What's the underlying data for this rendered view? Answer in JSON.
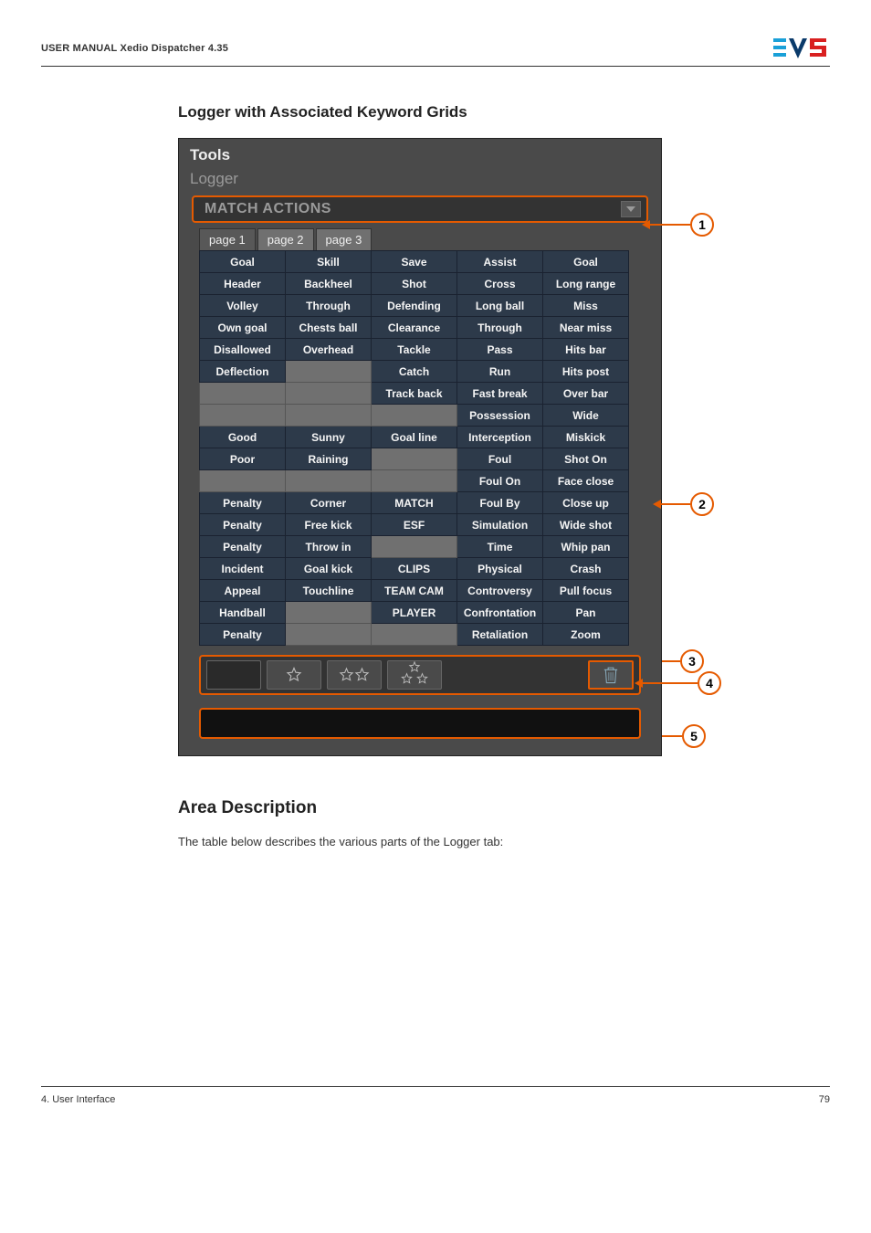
{
  "header": {
    "manual_label": "USER MANUAL Xedio Dispatcher 4.35",
    "brand": "EVS"
  },
  "section_title": "Logger with Associated Keyword Grids",
  "pane": {
    "tools_title": "Tools",
    "logger_title": "Logger",
    "match_actions": "MATCH ACTIONS",
    "tabs": [
      "page 1",
      "page 2",
      "page 3"
    ],
    "active_tab_index": 0,
    "grid": [
      [
        "Goal",
        "Skill",
        "Save",
        "Assist",
        "Goal"
      ],
      [
        "Header",
        "Backheel",
        "Shot",
        "Cross",
        "Long range"
      ],
      [
        "Volley",
        "Through",
        "Defending",
        "Long ball",
        "Miss"
      ],
      [
        "Own goal",
        "Chests ball",
        "Clearance",
        "Through",
        "Near miss"
      ],
      [
        "Disallowed",
        "Overhead",
        "Tackle",
        "Pass",
        "Hits bar"
      ],
      [
        "Deflection",
        "",
        "Catch",
        "Run",
        "Hits post"
      ],
      [
        "",
        "",
        "Track back",
        "Fast break",
        "Over bar"
      ],
      [
        "",
        "",
        "",
        "Possession",
        "Wide"
      ],
      [
        "Good",
        "Sunny",
        "Goal line",
        "Interception",
        "Miskick"
      ],
      [
        "Poor",
        "Raining",
        "",
        "Foul",
        "Shot On"
      ],
      [
        "",
        "",
        "",
        "Foul On",
        "Face close"
      ],
      [
        "Penalty",
        "Corner",
        "MATCH",
        "Foul By",
        "Close up"
      ],
      [
        "Penalty",
        "Free kick",
        "ESF",
        "Simulation",
        "Wide shot"
      ],
      [
        "Penalty",
        "Throw in",
        "",
        "Time",
        "Whip pan"
      ],
      [
        "Incident",
        "Goal kick",
        "CLIPS",
        "Physical",
        "Crash"
      ],
      [
        "Appeal",
        "Touchline",
        "TEAM CAM",
        "Controversy",
        "Pull focus"
      ],
      [
        "Handball",
        "",
        "PLAYER",
        "Confrontation",
        "Pan"
      ],
      [
        "Penalty",
        "",
        "",
        "Retaliation",
        "Zoom"
      ]
    ],
    "icons": {
      "color_swatch": "color-swatch",
      "star1": "star-outline",
      "star2": "two-stars-outline",
      "star3": "three-stars-outline",
      "trash": "trash-icon"
    }
  },
  "callouts": {
    "c1": "1",
    "c2": "2",
    "c3": "3",
    "c4": "4",
    "c5": "5"
  },
  "area_desc": {
    "title": "Area Description",
    "text": "The table below describes the various parts of the Logger tab:"
  },
  "footer": {
    "left": "4. User Interface",
    "right": "79"
  }
}
